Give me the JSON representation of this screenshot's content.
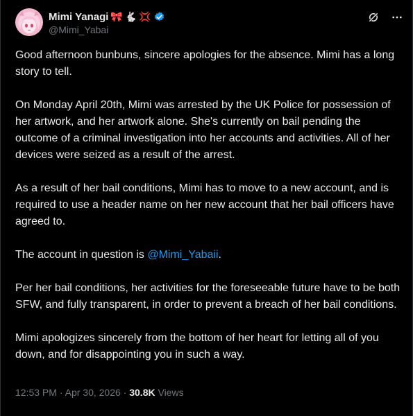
{
  "author": {
    "display_name": "Mimi Yanagi",
    "name_emojis": [
      "🎀",
      "🐇",
      "💢"
    ],
    "handle": "@Mimi_Yabai",
    "verified": true,
    "avatar_icon": "anime-avatar-icon"
  },
  "header_actions": [
    {
      "icon": "grok-icon"
    },
    {
      "icon": "more-icon"
    }
  ],
  "tweet": {
    "p1": "Good afternoon bunbuns, sincere apologies for the absence. Mimi has a long story to tell.",
    "p2": "On Monday April 20th, Mimi was arrested by the UK Police for possession of her artwork, and her artwork alone. She's currently on bail pending the outcome of a criminal investigation into her accounts and activities. All of her devices were seized as a result of the arrest.",
    "p3": "As a result of her bail conditions, Mimi has to move to a new account, and is required to use a header name on her new account that her bail officers have agreed to.",
    "p4_prefix": "The account in question is ",
    "p4_mention": "@Mimi_Yabaii",
    "p4_suffix": ".",
    "p5": "Per her bail conditions, her activities for the foreseeable future have to be both SFW, and fully transparent, in order to prevent a breach of her bail conditions.",
    "p6": "Mimi apologizes sincerely from the bottom of her heart for letting all of you down, and for disappointing you in such a way."
  },
  "meta": {
    "time": "12:53 PM",
    "separator": " · ",
    "date": "Apr 30, 2026",
    "views_count": "30.8K",
    "views_label": " Views"
  },
  "colors": {
    "background": "#000000",
    "text": "#e7e9ea",
    "secondary": "#71767b",
    "link": "#1d9bf0",
    "verified": "#1d9bf0"
  }
}
